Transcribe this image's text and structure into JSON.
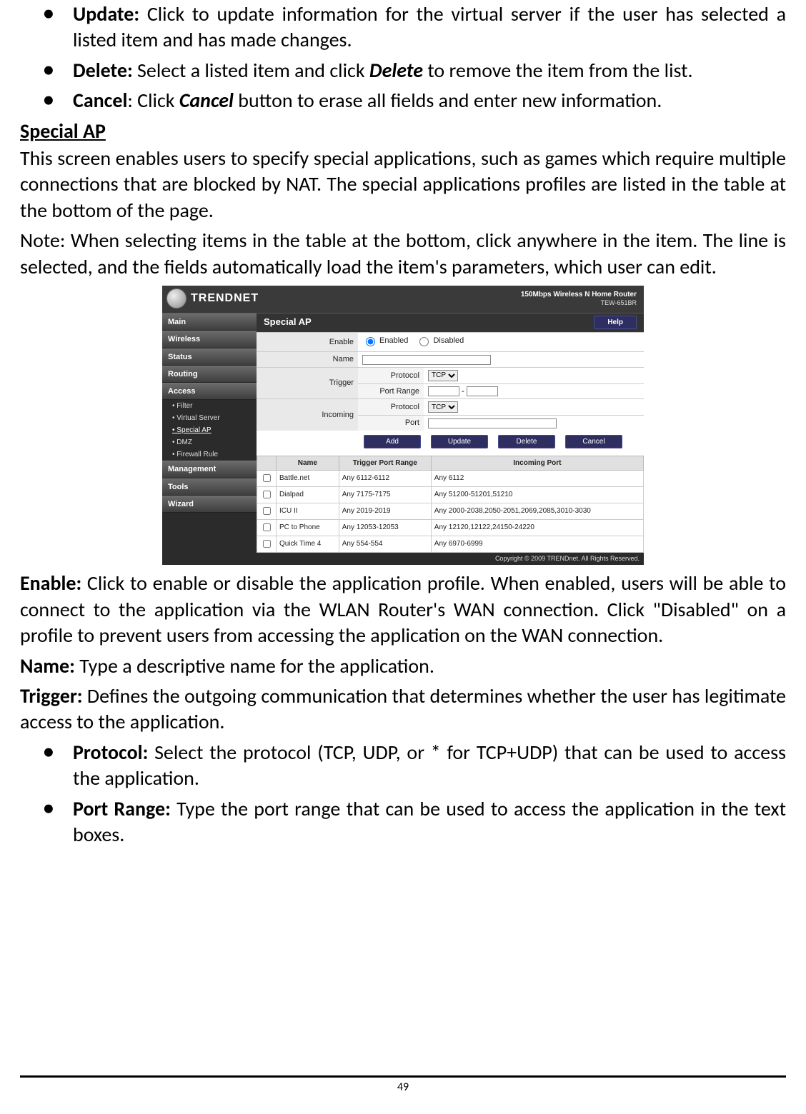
{
  "bulletsTop": [
    {
      "label": "Update:",
      "text": " Click to update information for the virtual server if the user has selected a listed item and has made changes."
    },
    {
      "label": "Delete:",
      "text_a": " Select a listed item and click ",
      "strong": "Delete",
      "text_b": " to remove the item from the list."
    },
    {
      "label": "Cancel",
      "text_a": ": Click ",
      "strong": "Cancel",
      "text_b": " button to erase all fields and enter new information."
    }
  ],
  "specialAP": {
    "heading": "Special AP",
    "para1": "This screen enables users to specify special applications, such as games which require multiple connections that are blocked by NAT. The special applications profiles are listed in the table at the bottom of the page.",
    "para2": "Note: When selecting items in the table at the bottom, click anywhere in the item. The line is selected, and the fields automatically load the item's parameters, which user can edit."
  },
  "router": {
    "brand": "TRENDNET",
    "model_line1": "150Mbps Wireless N Home Router",
    "model_line2": "TEW-651BR",
    "nav": [
      "Main",
      "Wireless",
      "Status",
      "Routing",
      "Access"
    ],
    "nav_sub": [
      "• Filter",
      "• Virtual Server",
      "• Special AP",
      "• DMZ",
      "• Firewall Rule"
    ],
    "nav_tail": [
      "Management",
      "Tools",
      "Wizard"
    ],
    "panel_title": "Special AP",
    "help": "Help",
    "form": {
      "enable_label": "Enable",
      "enabled": "Enabled",
      "disabled": "Disabled",
      "name_label": "Name",
      "trigger_label": "Trigger",
      "incoming_label": "Incoming",
      "protocol_label": "Protocol",
      "port_range_label": "Port Range",
      "port_label": "Port",
      "proto_val": "TCP"
    },
    "buttons": {
      "add": "Add",
      "update": "Update",
      "delete": "Delete",
      "cancel": "Cancel"
    },
    "tableHead": {
      "name": "Name",
      "tpr": "Trigger Port Range",
      "ip": "Incoming Port"
    },
    "tableRows": [
      {
        "name": "Battle.net",
        "tpr": "Any 6112-6112",
        "ip": "Any 6112"
      },
      {
        "name": "Dialpad",
        "tpr": "Any 7175-7175",
        "ip": "Any 51200-51201,51210"
      },
      {
        "name": "ICU II",
        "tpr": "Any 2019-2019",
        "ip": "Any 2000-2038,2050-2051,2069,2085,3010-3030"
      },
      {
        "name": "PC to Phone",
        "tpr": "Any 12053-12053",
        "ip": "Any 12120,12122,24150-24220"
      },
      {
        "name": "Quick Time 4",
        "tpr": "Any 554-554",
        "ip": "Any 6970-6999"
      }
    ],
    "copyright": "Copyright © 2009 TRENDnet. All Rights Reserved."
  },
  "afterShot": {
    "enable_label": "Enable:",
    "enable_text": " Click to enable or disable the application profile. When enabled, users will be able to connect to the application via the WLAN Router's WAN connection. Click \"Disabled\" on a profile to prevent users from accessing the application on the WAN connection.",
    "name_label": "Name:",
    "name_text": " Type a descriptive name for the application.",
    "trigger_label": "Trigger:",
    "trigger_text": " Defines the outgoing communication that determines whether the user has legitimate access to the application."
  },
  "bulletsBottom": [
    {
      "label": "Protocol:",
      "text": " Select the protocol (TCP, UDP, or * for TCP+UDP) that can be used to access the application."
    },
    {
      "label": "Port Range:",
      "text": " Type the port range that can be used to access the application in the text boxes."
    }
  ],
  "pageNumber": "49"
}
